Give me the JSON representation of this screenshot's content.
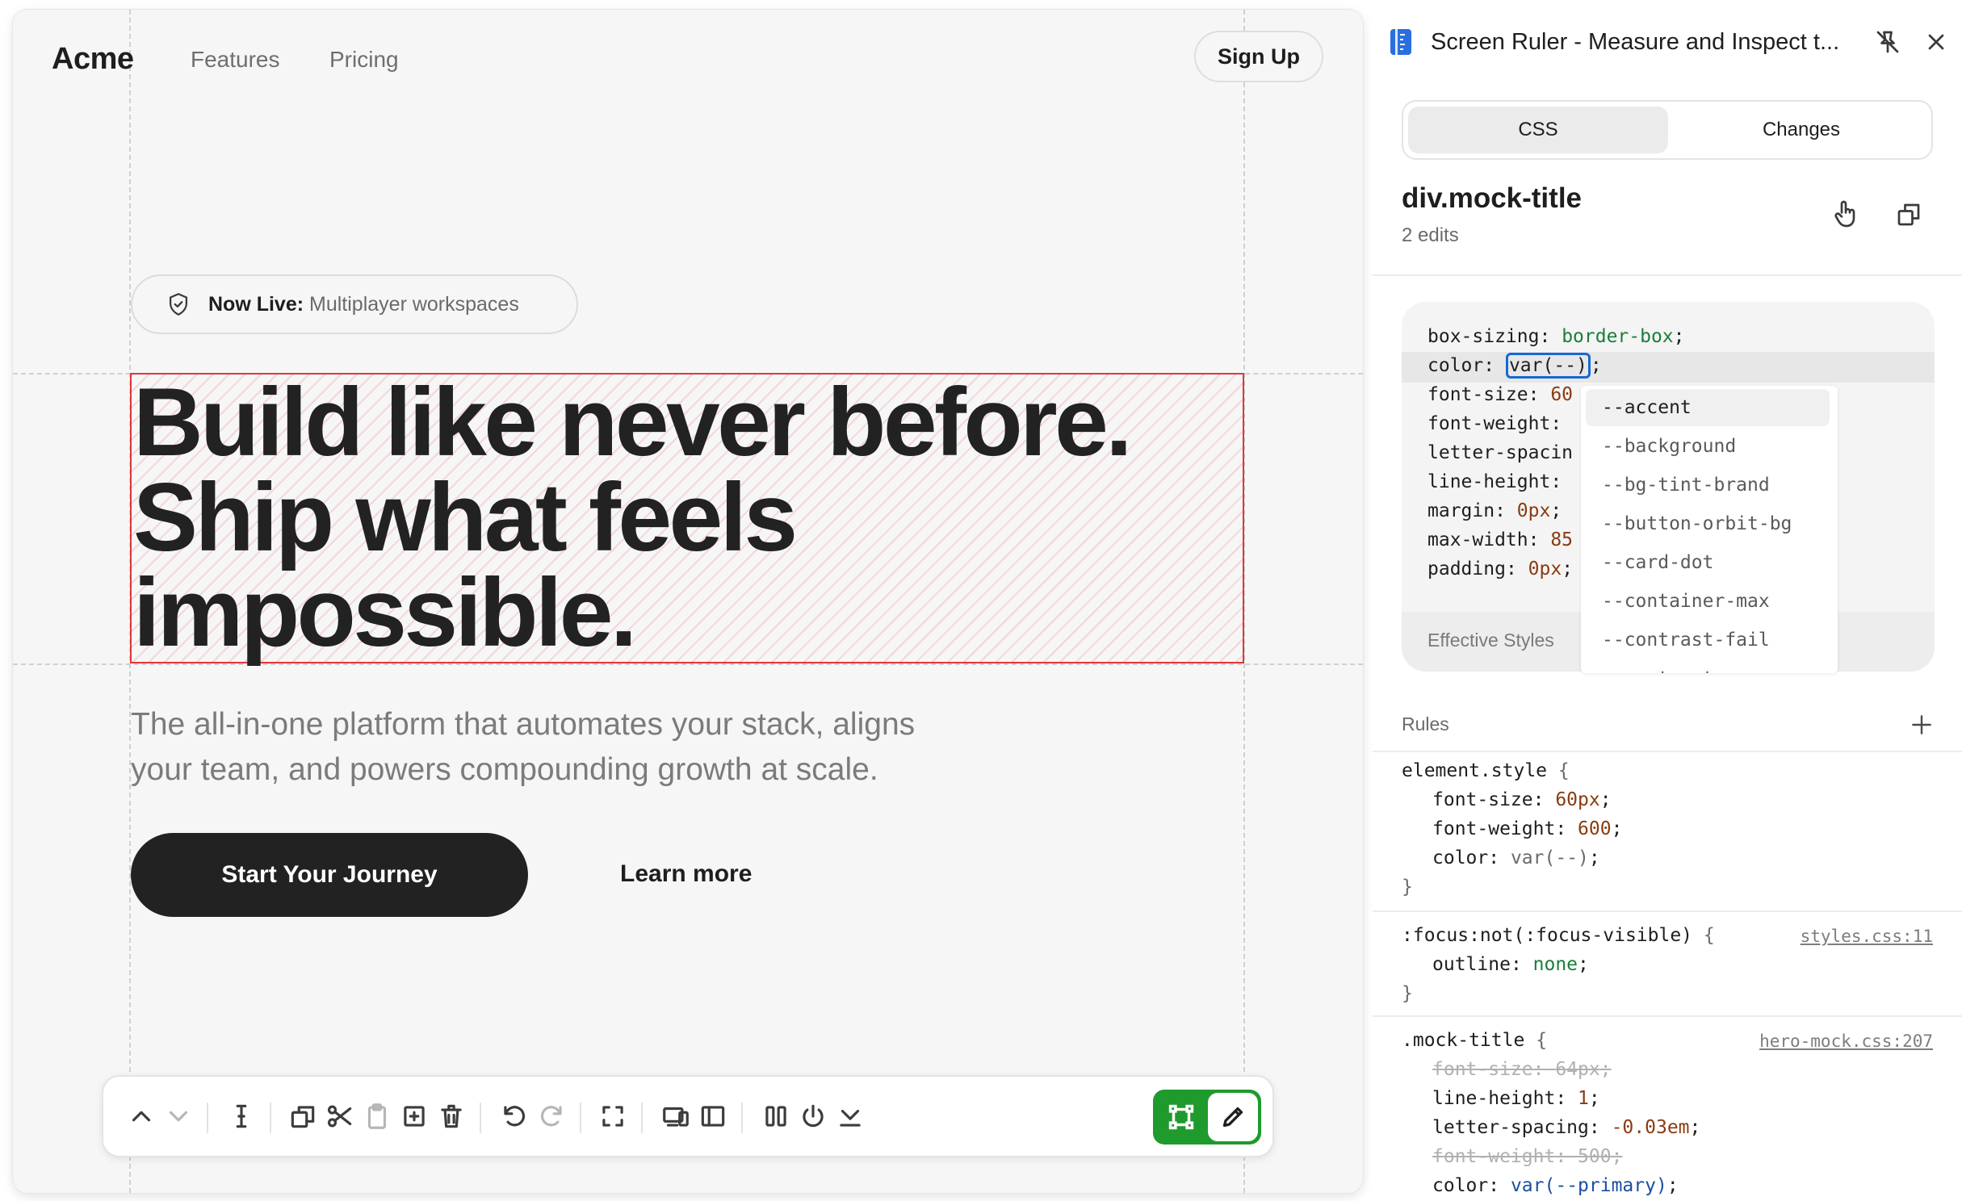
{
  "preview": {
    "nav": {
      "logo": "Acme",
      "links": [
        "Features",
        "Pricing"
      ],
      "signup": "Sign Up"
    },
    "badge": {
      "strong": "Now Live:",
      "text": " Multiplayer workspaces"
    },
    "hero": {
      "title_lines": [
        "Build like never before.",
        "Ship what feels",
        "impossible."
      ],
      "subtitle_lines": [
        "The all-in-one platform that automates your stack, aligns",
        "your team, and powers compounding growth at scale."
      ],
      "cta": "Start Your Journey",
      "learn_more": "Learn more"
    },
    "toolbar": {
      "icons": [
        "chevron-up-icon",
        "chevron-down-icon",
        "text-cursor-icon",
        "duplicate-icon",
        "scissors-icon",
        "clipboard-icon",
        "add-box-icon",
        "trash-icon",
        "undo-icon",
        "redo-icon",
        "fullscreen-icon",
        "devices-icon",
        "sidebar-icon",
        "columns-icon",
        "power-icon",
        "collapse-icon",
        "select-frame-icon",
        "pencil-icon"
      ]
    }
  },
  "panel": {
    "title": "Screen Ruler - Measure and Inspect t...",
    "tabs": [
      "CSS",
      "Changes"
    ],
    "active_tab": "CSS",
    "element": {
      "name": "div.mock-title",
      "edits": "2 edits"
    },
    "computed": [
      {
        "prop": "box-sizing",
        "value": "border-box"
      },
      {
        "prop": "color",
        "value": "var(--)"
      },
      {
        "prop": "font-size",
        "value": "60"
      },
      {
        "prop": "font-weight",
        "value": ""
      },
      {
        "prop": "letter-spacin",
        "value": ""
      },
      {
        "prop": "line-height",
        "value": ""
      },
      {
        "prop": "margin",
        "value": "0px"
      },
      {
        "prop": "max-width",
        "value": "85"
      },
      {
        "prop": "padding",
        "value": "0px"
      }
    ],
    "effective_styles": "Effective Styles",
    "autocomplete": [
      "--accent",
      "--background",
      "--bg-tint-brand",
      "--button-orbit-bg",
      "--card-dot",
      "--container-max",
      "--contrast-fail",
      "--contrast-pass"
    ],
    "rules_label": "Rules",
    "rules": [
      {
        "selector": "element.style",
        "source": "",
        "decls": [
          {
            "prop": "font-size",
            "value": "60px",
            "struck": false
          },
          {
            "prop": "font-weight",
            "value": "600",
            "struck": false
          },
          {
            "prop": "color",
            "value": "var(--)",
            "struck": false
          }
        ]
      },
      {
        "selector": ":focus:not(:focus-visible)",
        "source": "styles.css:11",
        "decls": [
          {
            "prop": "outline",
            "value": "none",
            "struck": false
          }
        ]
      },
      {
        "selector": ".mock-title",
        "source": "hero-mock.css:207",
        "decls": [
          {
            "prop": "font-size",
            "value": "64px",
            "struck": true
          },
          {
            "prop": "line-height",
            "value": "1",
            "struck": false
          },
          {
            "prop": "letter-spacing",
            "value": "-0.03em",
            "struck": false
          },
          {
            "prop": "font-weight",
            "value": "500",
            "struck": true
          },
          {
            "prop": "color",
            "value": "var(--primary)",
            "struck": false
          }
        ]
      }
    ]
  },
  "colors": {
    "selection_outline": "#e0373b",
    "cta_bg": "#222222",
    "active_tool_green": "#1f9a2c",
    "var_focus_blue": "#1669d3"
  }
}
